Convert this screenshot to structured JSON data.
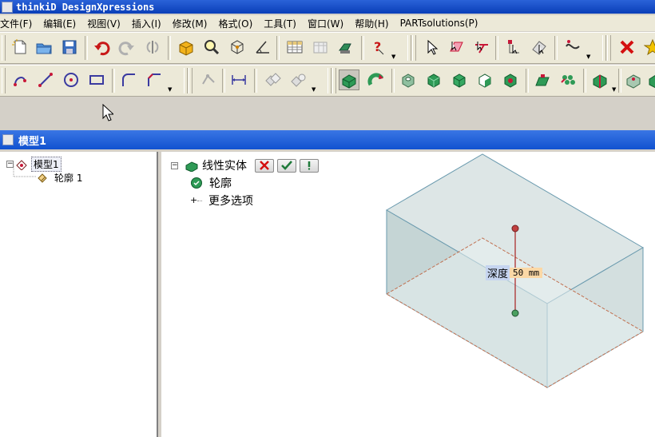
{
  "app": {
    "title": "thinkiD DesignXpressions"
  },
  "menu": {
    "items": [
      "文件(F)",
      "编辑(E)",
      "视图(V)",
      "插入(I)",
      "修改(M)",
      "格式(O)",
      "工具(T)",
      "窗口(W)",
      "帮助(H)",
      "PARTsolutions(P)"
    ]
  },
  "document": {
    "title": "模型1"
  },
  "model_tree": {
    "root": "模型1",
    "children": [
      "轮廓 1"
    ]
  },
  "feature_panel": {
    "feature_label": "线性实体",
    "profile_label": "轮廓",
    "more_options_label": "更多选项"
  },
  "dimension": {
    "label": "深度",
    "value": "50 mm"
  },
  "colors": {
    "title_bar": "#0a3fb8",
    "solid_face": "#cfdcdc",
    "solid_edge": "#5b8fa6",
    "dim_label_bg": "#c6d5f0",
    "dim_value_bg": "#fbd8a6"
  },
  "icons": {
    "toolbar1": [
      "new-document-icon",
      "open-folder-icon",
      "save-icon",
      "undo-icon",
      "redo-icon",
      "mirror-icon",
      "box-icon",
      "zoom-icon",
      "cube-wire-icon",
      "angle-icon",
      "table-icon",
      "table2-icon",
      "machine-icon",
      "help-query-icon",
      "select-arrow-icon",
      "select-face-icon",
      "select-edge-icon",
      "select-point-icon",
      "select-body-icon",
      "curve-tool-icon",
      "delete-icon",
      "star-icon"
    ],
    "toolbar2": [
      "line-icon",
      "sketch-line-icon",
      "circle-icon",
      "rectangle-icon",
      "fillet-icon",
      "chamfer-icon",
      "constraint-icon",
      "dimension-icon",
      "pattern-icon",
      "pattern2-icon",
      "extrude-icon",
      "revolve-icon",
      "hole-icon",
      "solid-green-icon",
      "solid-green2-icon",
      "solid-green3-icon",
      "solid-green4-icon",
      "shell-icon",
      "fillet-solid-icon",
      "array-icon",
      "split-icon",
      "body-icon"
    ]
  }
}
